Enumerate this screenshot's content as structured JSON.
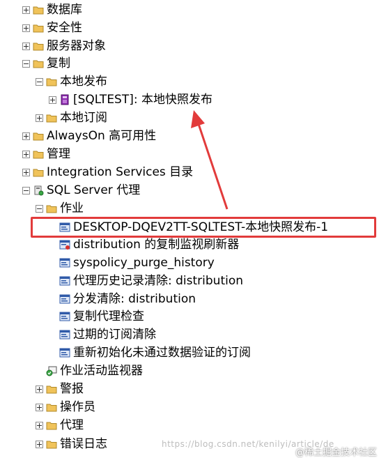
{
  "tree": {
    "items": [
      {
        "label": "数据库",
        "icon": "folder-icon",
        "expanded": false
      },
      {
        "label": "安全性",
        "icon": "folder-icon",
        "expanded": false
      },
      {
        "label": "服务器对象",
        "icon": "folder-icon",
        "expanded": false
      },
      {
        "label": "复制",
        "icon": "folder-icon",
        "expanded": true
      },
      {
        "label": "本地发布",
        "icon": "folder-icon",
        "expanded": true
      },
      {
        "label": "[SQLTEST]: 本地快照发布",
        "icon": "publication-icon",
        "expanded": false
      },
      {
        "label": "本地订阅",
        "icon": "folder-icon",
        "expanded": false
      },
      {
        "label": "AlwaysOn 高可用性",
        "icon": "folder-icon",
        "expanded": false
      },
      {
        "label": "管理",
        "icon": "folder-icon",
        "expanded": false
      },
      {
        "label": "Integration Services 目录",
        "icon": "folder-icon",
        "expanded": false
      },
      {
        "label": "SQL Server 代理",
        "icon": "sql-agent-icon",
        "expanded": true
      },
      {
        "label": "作业",
        "icon": "folder-icon",
        "expanded": true
      },
      {
        "label": "DESKTOP-DQEV2TT-SQLTEST-本地快照发布-1",
        "icon": "job-icon"
      },
      {
        "label": "distribution 的复制监视刷新器",
        "icon": "job-error-icon"
      },
      {
        "label": "syspolicy_purge_history",
        "icon": "job-icon"
      },
      {
        "label": "代理历史记录清除: distribution",
        "icon": "job-icon"
      },
      {
        "label": "分发清除: distribution",
        "icon": "job-icon"
      },
      {
        "label": "复制代理检查",
        "icon": "job-icon"
      },
      {
        "label": "过期的订阅清除",
        "icon": "job-icon"
      },
      {
        "label": "重新初始化未通过数据验证的订阅",
        "icon": "job-icon"
      },
      {
        "label": "作业活动监视器",
        "icon": "activity-monitor-icon"
      },
      {
        "label": "警报",
        "icon": "folder-icon",
        "expanded": false
      },
      {
        "label": "操作员",
        "icon": "folder-icon",
        "expanded": false
      },
      {
        "label": "代理",
        "icon": "folder-icon",
        "expanded": false
      },
      {
        "label": "错误日志",
        "icon": "folder-icon",
        "expanded": false
      }
    ]
  },
  "watermark": {
    "text": "https://blog.csdn.net/kenilyi/article/de",
    "site": "@稀土掘金技术社区"
  },
  "colors": {
    "highlight_border": "#e23b3b",
    "folder": "#f0c35a",
    "job_icon": "#2f5aa8"
  }
}
